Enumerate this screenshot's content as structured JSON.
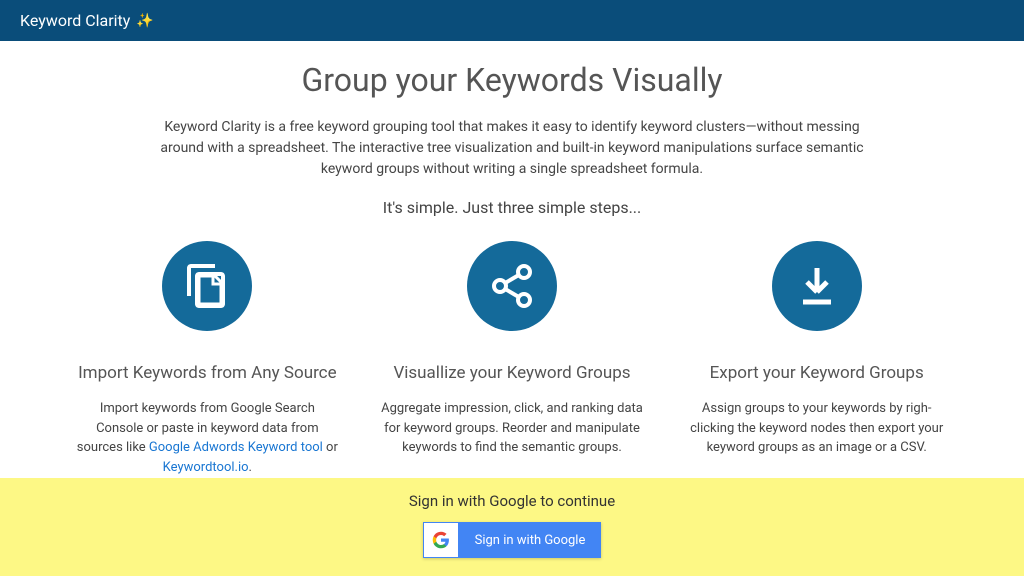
{
  "header": {
    "brand": "Keyword Clarity"
  },
  "main": {
    "title": "Group your Keywords Visually",
    "description": "Keyword Clarity is a free keyword grouping tool that makes it easy to identify keyword clusters—without messing around with a spreadsheet. The interactive tree visualization and built-in keyword manipulations surface semantic keyword groups without writing a single spreadsheet formula.",
    "subtitle": "It's simple. Just three simple steps..."
  },
  "steps": [
    {
      "title": "Import Keywords from Any Source",
      "desc_prefix": "Import keywords from Google Search Console or paste in keyword data from sources like ",
      "link1": "Google Adwords Keyword tool",
      "or": " or ",
      "link2": "Keywordtool.io",
      "suffix": "."
    },
    {
      "title": "Visuallize your Keyword Groups",
      "desc": "Aggregate impression, click, and ranking data for keyword groups. Reorder and manipulate keywords to find the semantic groups."
    },
    {
      "title": "Export your Keyword Groups",
      "desc": "Assign groups to your keywords by righ-clicking the keyword nodes then export your keyword groups as an image or a CSV."
    }
  ],
  "signin": {
    "label": "Sign in with Google to continue",
    "button": "Sign in with Google"
  }
}
